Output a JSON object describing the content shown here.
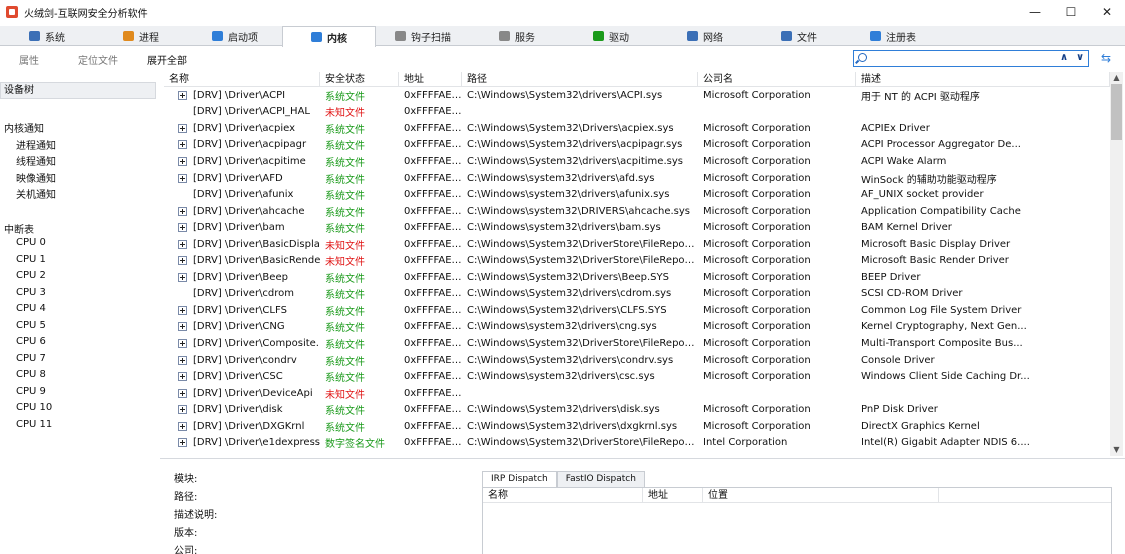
{
  "window": {
    "title": "火绒剑-互联网安全分析软件",
    "controls": [
      "—",
      "☐",
      "✕"
    ]
  },
  "tabs": [
    {
      "label": "系统",
      "icon": "system-icon",
      "color": "#3b6fb6"
    },
    {
      "label": "进程",
      "icon": "process-icon",
      "color": "#e08a1e"
    },
    {
      "label": "启动项",
      "icon": "startup-icon",
      "color": "#2f7ed8"
    },
    {
      "label": "内核",
      "icon": "kernel-icon",
      "color": "#2f7ed8",
      "active": true
    },
    {
      "label": "钩子扫描",
      "icon": "hook-icon",
      "color": "#888888"
    },
    {
      "label": "服务",
      "icon": "service-icon",
      "color": "#888888"
    },
    {
      "label": "驱动",
      "icon": "driver-icon",
      "color": "#1a9a1a"
    },
    {
      "label": "网络",
      "icon": "network-icon",
      "color": "#3b6fb6"
    },
    {
      "label": "文件",
      "icon": "file-icon",
      "color": "#3b6fb6"
    },
    {
      "label": "注册表",
      "icon": "registry-icon",
      "color": "#2f7ed8"
    }
  ],
  "subbar": {
    "items": [
      "属性",
      "定位文件",
      "展开全部"
    ],
    "search_placeholder": "",
    "nav_up": "∧",
    "nav_down": "∨"
  },
  "sidebar": {
    "head": "设备树",
    "sections": [
      {
        "title": "内核通知",
        "items": [
          "进程通知",
          "线程通知",
          "映像通知",
          "关机通知"
        ]
      },
      {
        "title": "中断表",
        "items": [
          "CPU 0",
          "CPU 1",
          "CPU 2",
          "CPU 3",
          "CPU 4",
          "CPU 5",
          "CPU 6",
          "CPU 7",
          "CPU 8",
          "CPU 9",
          "CPU 10",
          "CPU 11"
        ]
      }
    ]
  },
  "table": {
    "headers": [
      "名称",
      "安全状态",
      "地址",
      "路径",
      "公司名",
      "描述"
    ],
    "rows": [
      {
        "expand": true,
        "name": "[DRV] \\Driver\\ACPI",
        "status": "系统文件",
        "status_color": "green",
        "addr": "0xFFFFAE05...",
        "path": "C:\\Windows\\System32\\drivers\\ACPI.sys",
        "company": "Microsoft Corporation",
        "desc": "用于 NT 的 ACPI 驱动程序"
      },
      {
        "expand": false,
        "name": "[DRV] \\Driver\\ACPI_HAL",
        "status": "未知文件",
        "status_color": "red",
        "addr": "0xFFFFAE05...",
        "path": "",
        "company": "",
        "desc": ""
      },
      {
        "expand": true,
        "name": "[DRV] \\Driver\\acpiex",
        "status": "系统文件",
        "status_color": "green",
        "addr": "0xFFFFAE05...",
        "path": "C:\\Windows\\System32\\Drivers\\acpiex.sys",
        "company": "Microsoft Corporation",
        "desc": "ACPIEx Driver"
      },
      {
        "expand": true,
        "name": "[DRV] \\Driver\\acpipagr",
        "status": "系统文件",
        "status_color": "green",
        "addr": "0xFFFFAE05...",
        "path": "C:\\Windows\\System32\\drivers\\acpipagr.sys",
        "company": "Microsoft Corporation",
        "desc": "ACPI Processor Aggregator De..."
      },
      {
        "expand": true,
        "name": "[DRV] \\Driver\\acpitime",
        "status": "系统文件",
        "status_color": "green",
        "addr": "0xFFFFAE05...",
        "path": "C:\\Windows\\System32\\drivers\\acpitime.sys",
        "company": "Microsoft Corporation",
        "desc": "ACPI Wake Alarm"
      },
      {
        "expand": true,
        "name": "[DRV] \\Driver\\AFD",
        "status": "系统文件",
        "status_color": "green",
        "addr": "0xFFFFAE05...",
        "path": "C:\\Windows\\system32\\drivers\\afd.sys",
        "company": "Microsoft Corporation",
        "desc": "WinSock 的辅助功能驱动程序"
      },
      {
        "expand": false,
        "name": "[DRV] \\Driver\\afunix",
        "status": "系统文件",
        "status_color": "green",
        "addr": "0xFFFFAE05...",
        "path": "C:\\Windows\\system32\\drivers\\afunix.sys",
        "company": "Microsoft Corporation",
        "desc": "AF_UNIX socket provider"
      },
      {
        "expand": true,
        "name": "[DRV] \\Driver\\ahcache",
        "status": "系统文件",
        "status_color": "green",
        "addr": "0xFFFFAE05...",
        "path": "C:\\Windows\\system32\\DRIVERS\\ahcache.sys",
        "company": "Microsoft Corporation",
        "desc": "Application Compatibility Cache"
      },
      {
        "expand": true,
        "name": "[DRV] \\Driver\\bam",
        "status": "系统文件",
        "status_color": "green",
        "addr": "0xFFFFAE05...",
        "path": "C:\\Windows\\system32\\drivers\\bam.sys",
        "company": "Microsoft Corporation",
        "desc": "BAM Kernel Driver"
      },
      {
        "expand": true,
        "name": "[DRV] \\Driver\\BasicDisplay",
        "status": "未知文件",
        "status_color": "red",
        "addr": "0xFFFFAE05...",
        "path": "C:\\Windows\\System32\\DriverStore\\FileRepositor...",
        "company": "Microsoft Corporation",
        "desc": "Microsoft Basic Display Driver"
      },
      {
        "expand": true,
        "name": "[DRV] \\Driver\\BasicRender",
        "status": "未知文件",
        "status_color": "red",
        "addr": "0xFFFFAE05...",
        "path": "C:\\Windows\\System32\\DriverStore\\FileRepositor...",
        "company": "Microsoft Corporation",
        "desc": "Microsoft Basic Render Driver"
      },
      {
        "expand": true,
        "name": "[DRV] \\Driver\\Beep",
        "status": "系统文件",
        "status_color": "green",
        "addr": "0xFFFFAE05...",
        "path": "C:\\Windows\\System32\\Drivers\\Beep.SYS",
        "company": "Microsoft Corporation",
        "desc": "BEEP Driver"
      },
      {
        "expand": false,
        "name": "[DRV] \\Driver\\cdrom",
        "status": "系统文件",
        "status_color": "green",
        "addr": "0xFFFFAE05...",
        "path": "C:\\Windows\\System32\\drivers\\cdrom.sys",
        "company": "Microsoft Corporation",
        "desc": "SCSI CD-ROM Driver"
      },
      {
        "expand": true,
        "name": "[DRV] \\Driver\\CLFS",
        "status": "系统文件",
        "status_color": "green",
        "addr": "0xFFFFAE05...",
        "path": "C:\\Windows\\System32\\drivers\\CLFS.SYS",
        "company": "Microsoft Corporation",
        "desc": "Common Log File System Driver"
      },
      {
        "expand": true,
        "name": "[DRV] \\Driver\\CNG",
        "status": "系统文件",
        "status_color": "green",
        "addr": "0xFFFFAE05...",
        "path": "C:\\Windows\\system32\\drivers\\cng.sys",
        "company": "Microsoft Corporation",
        "desc": "Kernel Cryptography, Next Gen..."
      },
      {
        "expand": true,
        "name": "[DRV] \\Driver\\Composite...",
        "status": "系统文件",
        "status_color": "green",
        "addr": "0xFFFFAE05...",
        "path": "C:\\Windows\\System32\\DriverStore\\FileRepositor...",
        "company": "Microsoft Corporation",
        "desc": "Multi-Transport Composite Bus..."
      },
      {
        "expand": true,
        "name": "[DRV] \\Driver\\condrv",
        "status": "系统文件",
        "status_color": "green",
        "addr": "0xFFFFAE05...",
        "path": "C:\\Windows\\System32\\drivers\\condrv.sys",
        "company": "Microsoft Corporation",
        "desc": "Console Driver"
      },
      {
        "expand": true,
        "name": "[DRV] \\Driver\\CSC",
        "status": "系统文件",
        "status_color": "green",
        "addr": "0xFFFFAE05...",
        "path": "C:\\Windows\\system32\\drivers\\csc.sys",
        "company": "Microsoft Corporation",
        "desc": "Windows Client Side Caching Dr..."
      },
      {
        "expand": true,
        "name": "[DRV] \\Driver\\DeviceApi",
        "status": "未知文件",
        "status_color": "red",
        "addr": "0xFFFFAE05...",
        "path": "",
        "company": "",
        "desc": ""
      },
      {
        "expand": true,
        "name": "[DRV] \\Driver\\disk",
        "status": "系统文件",
        "status_color": "green",
        "addr": "0xFFFFAE05...",
        "path": "C:\\Windows\\System32\\drivers\\disk.sys",
        "company": "Microsoft Corporation",
        "desc": "PnP Disk Driver"
      },
      {
        "expand": true,
        "name": "[DRV] \\Driver\\DXGKrnl",
        "status": "系统文件",
        "status_color": "green",
        "addr": "0xFFFFAE05...",
        "path": "C:\\Windows\\System32\\drivers\\dxgkrnl.sys",
        "company": "Microsoft Corporation",
        "desc": "DirectX Graphics Kernel"
      },
      {
        "expand": true,
        "name": "[DRV] \\Driver\\e1dexpress",
        "status": "数字签名文件",
        "status_color": "green",
        "addr": "0xFFFFAE05...",
        "path": "C:\\Windows\\System32\\DriverStore\\FileRepositor...",
        "company": "Intel Corporation",
        "desc": "Intel(R) Gigabit Adapter NDIS 6...."
      }
    ]
  },
  "detail": {
    "labels": [
      "模块:",
      "路径:",
      "描述说明:",
      "版本:",
      "公司:"
    ],
    "irp_tabs": [
      "IRP Dispatch",
      "FastIO Dispatch"
    ],
    "irp_headers": [
      "名称",
      "地址",
      "位置"
    ]
  },
  "colors": {
    "green": "#1a9a1a",
    "red": "#e01414",
    "accent": "#2f7ed8"
  }
}
